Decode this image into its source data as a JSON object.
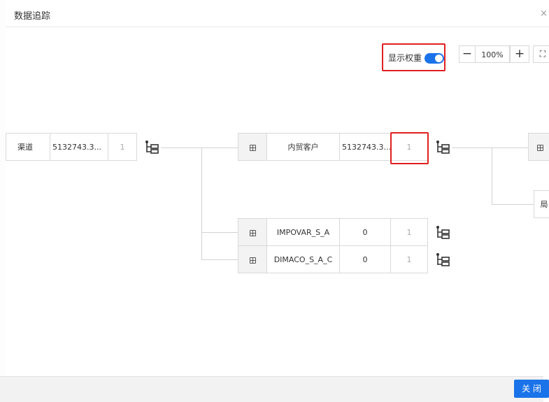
{
  "dialog": {
    "title": "数据追踪",
    "close_symbol": "×"
  },
  "toolbar": {
    "show_weight_label": "显示权重",
    "show_weight_on": true,
    "zoom_out": "−",
    "zoom_level": "100%",
    "zoom_in": "+",
    "fit_symbol": "⛶"
  },
  "nodes": {
    "left": {
      "name": "渠道",
      "value": "5132743.3...",
      "weight": "1"
    },
    "center": {
      "name": "内贸客户",
      "value": "5132743.3...",
      "weight": "1"
    },
    "children": [
      {
        "name": "IMPOVAR_S_A",
        "value": "0",
        "weight": "1"
      },
      {
        "name": "DIMACO_S_A_C",
        "value": "0",
        "weight": "1"
      }
    ],
    "right_partial": {
      "name": "局"
    }
  },
  "footer": {
    "close_label": "关 闭"
  },
  "icons": {
    "grid": "grid-icon",
    "tree": "tree-icon",
    "close": "close-icon",
    "fullscreen": "fullscreen-icon"
  },
  "colors": {
    "accent": "#1a73e8",
    "highlight": "#e02020"
  }
}
